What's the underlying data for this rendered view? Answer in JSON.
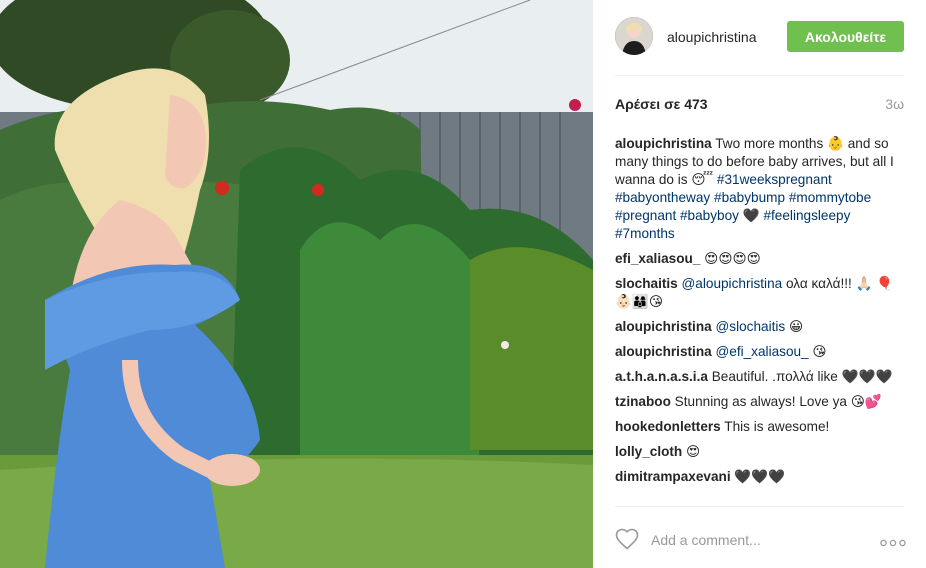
{
  "header": {
    "username": "aloupichristina",
    "follow_label": "Ακολουθείτε"
  },
  "meta": {
    "likes_label": "Αρέσει σε 473",
    "time_ago": "3ω"
  },
  "caption": {
    "user": "aloupichristina",
    "text1": "Two more months 👶️ and so many things to do before baby arrives, but all I wanna do is 😴",
    "tags1": "#31weekspregnant #babyontheway #babybump #mommytobe #pregnant #babyboy",
    "heart": "🖤",
    "tags2": "#feelingsleepy #7months"
  },
  "comments": [
    {
      "user": "efi_xaliasou_",
      "text": "😍😍😍😍"
    },
    {
      "user": "slochaitis",
      "mention": "@aloupichristina",
      "text": "ολα καλά!!! 🙏🏻 🎈👶🏻👨‍👩‍👦😘"
    },
    {
      "user": "aloupichristina",
      "mention": "@slochaitis",
      "text": "😀"
    },
    {
      "user": "aloupichristina",
      "mention": "@efi_xaliasou_",
      "text": "😘"
    },
    {
      "user": "a.t.h.a.n.a.s.i.a",
      "text": "Beautiful. .πολλά like 🖤🖤🖤"
    },
    {
      "user": "tzinaboo",
      "text": "Stunning as always! Love ya 😘💕"
    },
    {
      "user": "hookedonletters",
      "text": "This is awesome!"
    },
    {
      "user": "lolly_cloth",
      "text": "😍"
    },
    {
      "user": "dimitrampaxevani",
      "text": "🖤🖤🖤"
    }
  ],
  "footer": {
    "add_comment_placeholder": "Add a comment...",
    "heart_icon": "heart-outline-icon",
    "more_icon": "more-options-icon"
  },
  "colors": {
    "follow_button": "#70c050",
    "hashtag": "#003569",
    "muted": "#999999"
  }
}
